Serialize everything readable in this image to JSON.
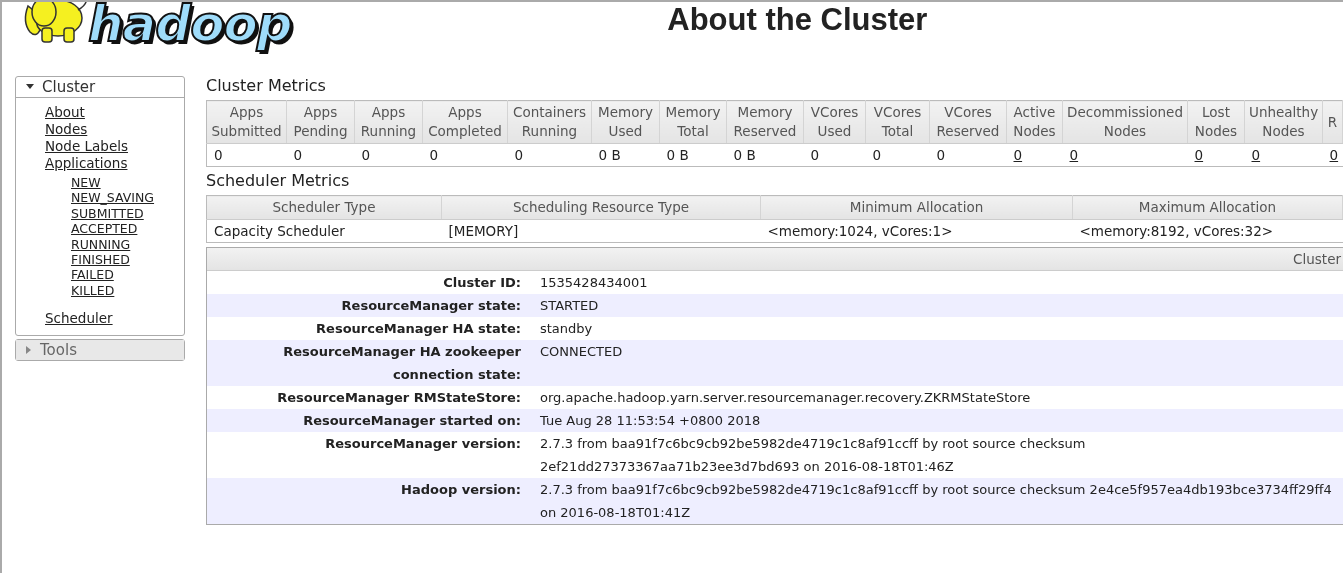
{
  "header": {
    "logo_text": "hadoop",
    "title": "About the Cluster"
  },
  "sidebar": [
    {
      "label": "Cluster",
      "expanded": true,
      "items": [
        {
          "label": "About"
        },
        {
          "label": "Nodes"
        },
        {
          "label": "Node Labels"
        },
        {
          "label": "Applications",
          "children": [
            {
              "label": "NEW"
            },
            {
              "label": "NEW_SAVING"
            },
            {
              "label": "SUBMITTED"
            },
            {
              "label": "ACCEPTED"
            },
            {
              "label": "RUNNING"
            },
            {
              "label": "FINISHED"
            },
            {
              "label": "FAILED"
            },
            {
              "label": "KILLED"
            }
          ]
        },
        {
          "label": "Scheduler"
        }
      ]
    },
    {
      "label": "Tools",
      "expanded": false
    }
  ],
  "cluster_metrics": {
    "title": "Cluster Metrics",
    "columns": [
      "Apps\nSubmitted",
      "Apps\nPending",
      "Apps\nRunning",
      "Apps\nCompleted",
      "Containers\nRunning",
      "Memory\nUsed",
      "Memory\nTotal",
      "Memory\nReserved",
      "VCores\nUsed",
      "VCores\nTotal",
      "VCores\nReserved",
      "Active\nNodes",
      "Decommissioned\nNodes",
      "Lost\nNodes",
      "Unhealthy\nNodes",
      "R"
    ],
    "row": [
      {
        "text": "0",
        "link": false
      },
      {
        "text": "0",
        "link": false
      },
      {
        "text": "0",
        "link": false
      },
      {
        "text": "0",
        "link": false
      },
      {
        "text": "0",
        "link": false
      },
      {
        "text": "0 B",
        "link": false
      },
      {
        "text": "0 B",
        "link": false
      },
      {
        "text": "0 B",
        "link": false
      },
      {
        "text": "0",
        "link": false
      },
      {
        "text": "0",
        "link": false
      },
      {
        "text": "0",
        "link": false
      },
      {
        "text": "0",
        "link": true
      },
      {
        "text": "0",
        "link": true
      },
      {
        "text": "0",
        "link": true
      },
      {
        "text": "0",
        "link": true
      },
      {
        "text": "0",
        "link": true
      }
    ]
  },
  "scheduler_metrics": {
    "title": "Scheduler Metrics",
    "columns": [
      "Scheduler Type",
      "Scheduling Resource Type",
      "Minimum Allocation",
      "Maximum Allocation"
    ],
    "row": [
      "Capacity Scheduler",
      "[MEMORY]",
      "<memory:1024, vCores:1>",
      "<memory:8192, vCores:32>"
    ]
  },
  "cluster_overview": {
    "header": "Cluster",
    "rows": [
      {
        "label": "Cluster ID:",
        "value": "1535428434001"
      },
      {
        "label": "ResourceManager state:",
        "value": "STARTED"
      },
      {
        "label": "ResourceManager HA state:",
        "value": "standby"
      },
      {
        "label": "ResourceManager HA zookeeper connection state:",
        "value": "CONNECTED"
      },
      {
        "label": "ResourceManager RMStateStore:",
        "value": "org.apache.hadoop.yarn.server.resourcemanager.recovery.ZKRMStateStore"
      },
      {
        "label": "ResourceManager started on:",
        "value": "Tue Aug 28 11:53:54 +0800 2018"
      },
      {
        "label": "ResourceManager version:",
        "value": "2.7.3 from baa91f7c6bc9cb92be5982de4719c1c8af91ccff by root source checksum 2ef21dd27373367aa71b23ee3d7bd693 on 2016-08-18T01:46Z"
      },
      {
        "label": "Hadoop version:",
        "value": "2.7.3 from baa91f7c6bc9cb92be5982de4719c1c8af91ccff by root source checksum 2e4ce5f957ea4db193bce3734ff29ff4 on 2016-08-18T01:41Z"
      }
    ]
  }
}
